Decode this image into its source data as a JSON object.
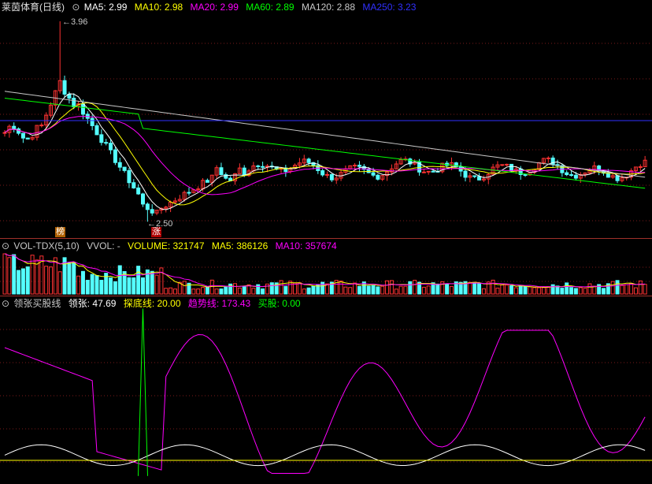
{
  "price_header": {
    "title": "莱茵体育(日线)",
    "ma5": "MA5: 2.99",
    "ma10": "MA10: 2.98",
    "ma20": "MA20: 2.99",
    "ma60": "MA60: 2.89",
    "ma120": "MA120: 2.88",
    "ma250": "MA250: 3.23",
    "high_label": "3.96",
    "low_label": "2.50",
    "tag_bang": "榜",
    "tag_zhang": "涨"
  },
  "vol_header": {
    "indicator": "VOL-TDX(5,10)",
    "vvol": "VVOL: -",
    "volume": "VOLUME: 321747",
    "ma5": "MA5: 386126",
    "ma10": "MA10: 357674"
  },
  "osc_header": {
    "indicator": "领张买股线",
    "lingzhang": "领张: 47.69",
    "tandi": "探底线: 20.00",
    "qushi": "趋势线: 173.43",
    "maigu": "买股: 0.00"
  },
  "colors": {
    "up": "#ff3232",
    "down": "#54ffff",
    "ma5": "#ffffff",
    "ma10": "#ffff00",
    "ma20": "#ff00ff",
    "ma60": "#00ff00",
    "ma120": "#c8c8c8",
    "ma250": "#3030ff",
    "grid": "#7a1a1a"
  },
  "chart_data": {
    "type": "candlestick",
    "price_high": 3.96,
    "price_low": 2.5,
    "trend": "sharp spike to 3.96 then decline to 2.50 low, followed by sideways consolidation near 2.9-3.0",
    "oscillator": {
      "tandi_level": 20.0,
      "note": "green spike early in series reaching top of pane"
    }
  }
}
